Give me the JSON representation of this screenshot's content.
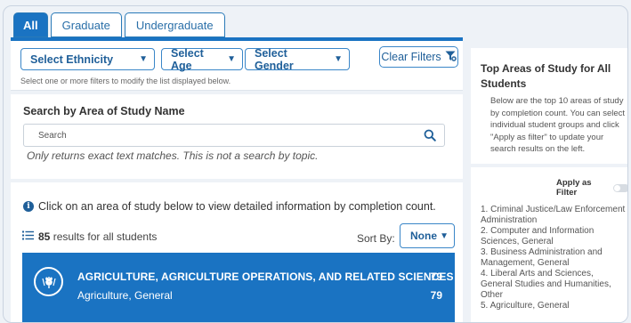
{
  "tabs": [
    "All",
    "Graduate",
    "Undergraduate"
  ],
  "filters": {
    "ethnicity": "Select Ethnicity",
    "age": "Select Age",
    "gender": "Select Gender",
    "clear_label": "Clear Filters",
    "hint": "Select one or more filters to modify the list displayed below."
  },
  "search": {
    "title": "Search by Area of Study Name",
    "placeholder": "Search",
    "note": "Only returns exact text matches. This is not a search by topic."
  },
  "results": {
    "info": "Click on an area of study below to view detailed information by completion count.",
    "count": "85",
    "count_suffix": " results for all students",
    "sort_label": "Sort By:",
    "sort_value": "None",
    "card": {
      "title": "AGRICULTURE, AGRICULTURE OPERATIONS, AND RELATED SCIENCES",
      "subtitle": "Agriculture, General",
      "count": "79",
      "sub_count": "79"
    }
  },
  "right": {
    "title": "Top Areas of Study for All Students",
    "description": "Below are the top 10 areas of study by completion count. You can select individual student groups and click \"Apply as filter\" to update your search results on the left.",
    "apply_label": "Apply as Filter",
    "top_list": [
      "1. Criminal Justice/Law Enforcement Administration",
      "2. Computer and Information Sciences, General",
      "3. Business Administration and Management, General",
      "4. Liberal Arts and Sciences, General Studies and Humanities, Other",
      "5. Agriculture, General"
    ]
  },
  "colors": {
    "accent": "#1a73c2",
    "background": "#eef2f7"
  },
  "icons": {
    "search": "search-icon",
    "clear": "filter-clear-icon",
    "info": "info-icon",
    "list": "list-icon",
    "card": "wheat-icon"
  }
}
